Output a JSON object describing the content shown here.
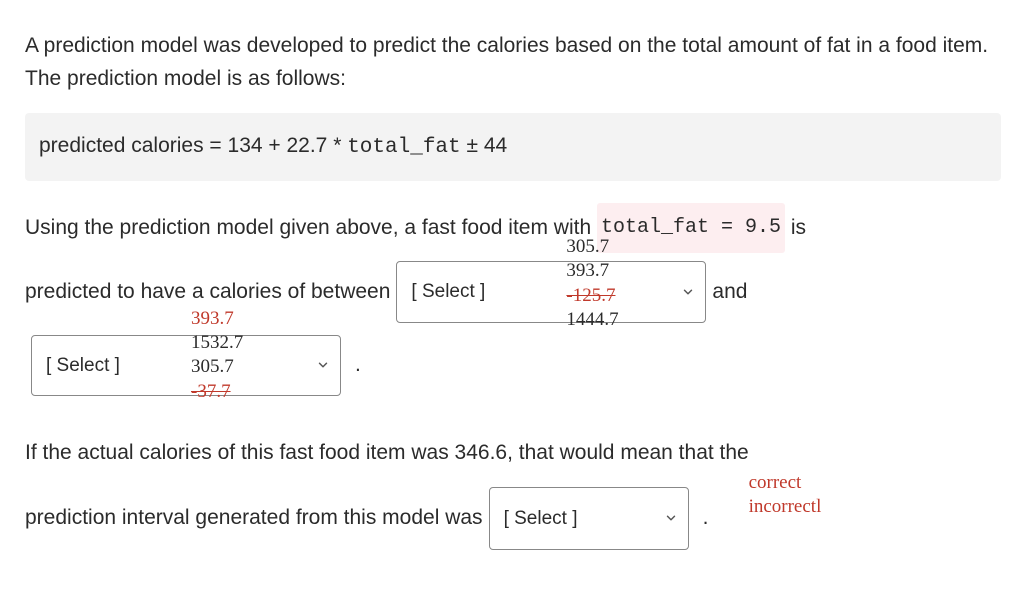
{
  "intro": "A prediction model was developed to predict the calories based on the total amount of fat in a food item. The prediction model is as follows:",
  "formula": {
    "prefix": "predicted calories = 134 + 22.7 * ",
    "var": "total_fat",
    "suffix": " ± 44"
  },
  "q1": {
    "part1": "Using the prediction model given above, a fast food item with ",
    "code": "total_fat = 9.5",
    "part2": " is",
    "line2_prefix": "predicted to have a calories of between",
    "select_placeholder": "[ Select ]",
    "and_text": "and",
    "period": "."
  },
  "select1_options": {
    "o1": "305.7",
    "o2": "393.7",
    "o3": "-125.7",
    "o4": "1444.7"
  },
  "select2_options": {
    "o1": "393.7",
    "o2": "1532.7",
    "o3": "305.7",
    "o4": "-37.7"
  },
  "q2": {
    "line1": "If the actual calories of this fast food item was 346.6, that would mean that the",
    "line2_prefix": "prediction interval generated from this model was",
    "select_placeholder": "[ Select ]",
    "period": "."
  },
  "select3_options": {
    "o1": "correct",
    "o2": "incorrectl"
  }
}
